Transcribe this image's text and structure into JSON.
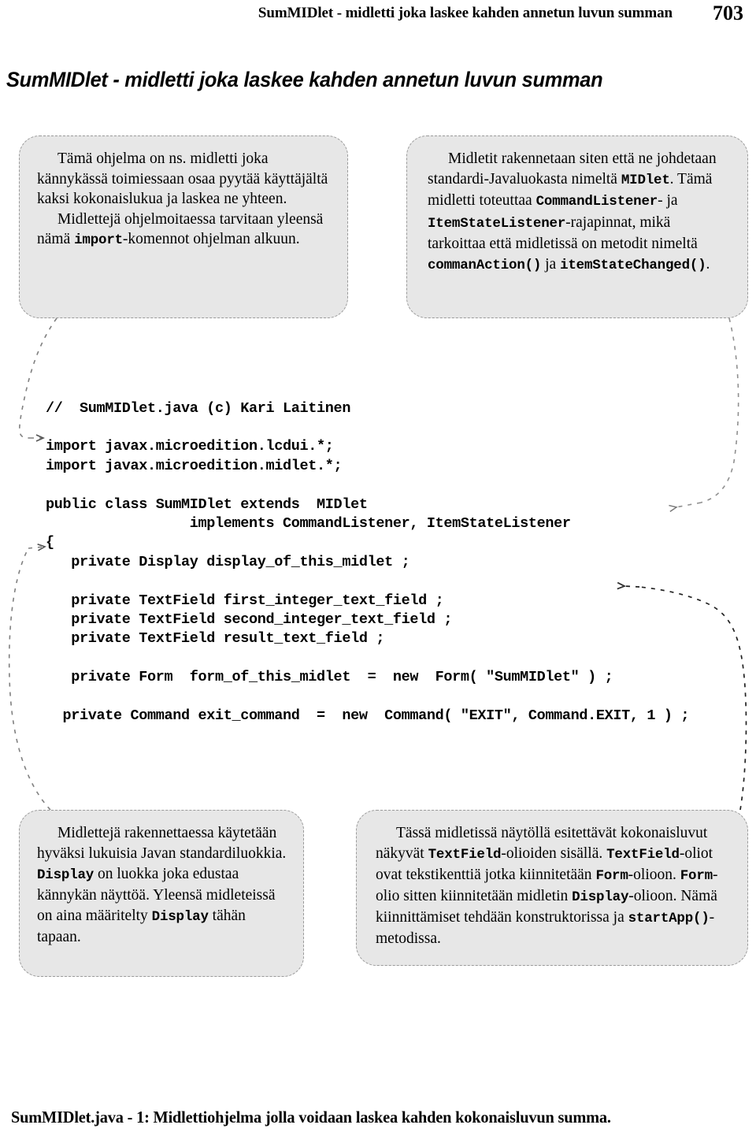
{
  "running_head": {
    "title": "SumMIDlet - midletti joka laskee kahden annetun luvun summan",
    "page_number": "703"
  },
  "page_title": "SumMIDlet - midletti joka laskee kahden annetun luvun summan",
  "callouts": {
    "top_left": {
      "paragraphs": [
        [
          {
            "t": "Tämä ohjelma on ns. midletti joka kännykässä toimiessaan osaa pyytää käyttäjältä kaksi kokonaislukua ja laskea ne yhteen.",
            "mono": false
          }
        ],
        [
          {
            "t": "Midlettejä ohjelmoitaessa tarvitaan yleensä nämä ",
            "mono": false
          },
          {
            "t": "import",
            "mono": true
          },
          {
            "t": "-komennot ohjelman alkuun.",
            "mono": false
          }
        ]
      ]
    },
    "top_right": {
      "paragraphs": [
        [
          {
            "t": "Midletit rakennetaan siten että ne johdetaan standardi-Javaluokasta nimeltä ",
            "mono": false
          },
          {
            "t": "MIDlet",
            "mono": true
          },
          {
            "t": ". Tämä midletti toteuttaa ",
            "mono": false
          },
          {
            "t": "CommandListener",
            "mono": true
          },
          {
            "t": "- ja ",
            "mono": false
          },
          {
            "t": "ItemStateListener",
            "mono": true
          },
          {
            "t": "-rajapinnat, mikä tarkoittaa että midletissä on metodit nimeltä ",
            "mono": false
          },
          {
            "t": "commanAction()",
            "mono": true
          },
          {
            "t": " ja ",
            "mono": false
          },
          {
            "t": "itemStateChanged()",
            "mono": true
          },
          {
            "t": ".",
            "mono": false
          }
        ]
      ]
    },
    "bottom_left": {
      "paragraphs": [
        [
          {
            "t": "Midlettejä rakennettaessa käytetään hyväksi lukuisia Javan standardiluokkia. ",
            "mono": false
          },
          {
            "t": "Display",
            "mono": true
          },
          {
            "t": " on luokka joka edustaa kännykän näyttöä. Yleensä midleteissä on aina määritelty ",
            "mono": false
          },
          {
            "t": "Display",
            "mono": true
          },
          {
            "t": " tähän tapaan.",
            "mono": false
          }
        ]
      ]
    },
    "bottom_right": {
      "paragraphs": [
        [
          {
            "t": "Tässä midletissä näytöllä esitettävät kokonaisluvut näkyvät ",
            "mono": false
          },
          {
            "t": "TextField",
            "mono": true
          },
          {
            "t": "-olioiden sisällä. ",
            "mono": false
          },
          {
            "t": "TextField",
            "mono": true
          },
          {
            "t": "-oliot ovat tekstikenttiä jotka kiinnitetään ",
            "mono": false
          },
          {
            "t": "Form",
            "mono": true
          },
          {
            "t": "-olioon. ",
            "mono": false
          },
          {
            "t": "Form",
            "mono": true
          },
          {
            "t": "-olio sitten kiinnitetään midletin ",
            "mono": false
          },
          {
            "t": "Display",
            "mono": true
          },
          {
            "t": "-olioon. Nämä kiinnittämiset tehdään konstruktorissa ja ",
            "mono": false
          },
          {
            "t": "startApp()",
            "mono": true
          },
          {
            "t": "-metodissa.",
            "mono": false
          }
        ]
      ]
    }
  },
  "code_listing": {
    "lines": [
      "//  SumMIDlet.java (c) Kari Laitinen",
      "",
      "import javax.microedition.lcdui.*;",
      "import javax.microedition.midlet.*;",
      "",
      "public class SumMIDlet extends  MIDlet",
      "                 implements CommandListener, ItemStateListener",
      "{",
      "   private Display display_of_this_midlet ;",
      "",
      "   private TextField first_integer_text_field ;",
      "   private TextField second_integer_text_field ;",
      "   private TextField result_text_field ;",
      "",
      "   private Form  form_of_this_midlet  =  new  Form( \"SumMIDlet\" ) ;",
      "",
      "  private Command exit_command  =  new  Command( \"EXIT\", Command.EXIT, 1 ) ;"
    ]
  },
  "caption": "SumMIDlet.java - 1: Midlettiohjelma jolla voidaan laskea kahden kokonaisluvun summa.",
  "colors": {
    "balloon_fill": "#e7e7e7",
    "balloon_border": "#9a9a9a",
    "text": "#000000",
    "page_background": "#ffffff"
  }
}
